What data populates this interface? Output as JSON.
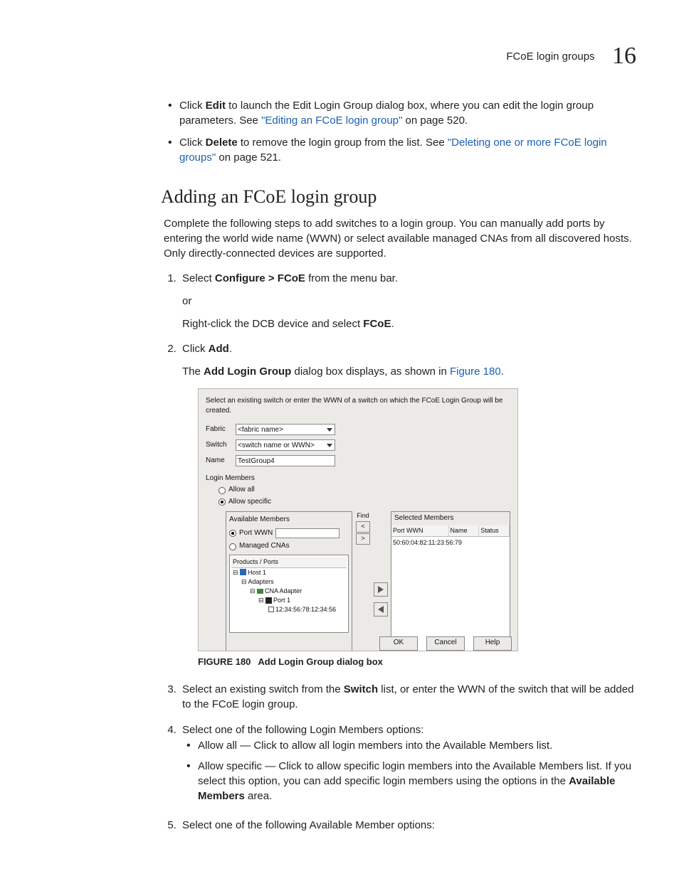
{
  "header": {
    "title": "FCoE login groups",
    "chapter": "16"
  },
  "prebullets": [
    {
      "pre": "Click ",
      "bold1": "Edit",
      "mid": " to launch the Edit Login Group dialog box, where you can edit the login group parameters. See ",
      "link": "\"Editing an FCoE login group\"",
      "post": " on page 520."
    },
    {
      "pre": "Click ",
      "bold1": "Delete",
      "mid": " to remove the login group from the list. See ",
      "link": "\"Deleting one or more FCoE login groups\"",
      "post": " on page 521."
    }
  ],
  "section_heading": "Adding an FCoE login group",
  "intro": "Complete the following steps to add switches to a login group. You can manually add ports by entering the world wide name (WWN) or select available managed CNAs from all discovered hosts. Only directly-connected devices are supported.",
  "steps": {
    "s1_pre": "Select ",
    "s1_bold": "Configure > FCoE",
    "s1_post": " from the menu bar.",
    "s1_or": "or",
    "s1_alt_pre": "Right-click the DCB device and select ",
    "s1_alt_bold": "FCoE",
    "s1_alt_post": ".",
    "s2_pre": "Click ",
    "s2_bold": "Add",
    "s2_post": ".",
    "s2_sub_pre": "The ",
    "s2_sub_bold": "Add Login Group",
    "s2_sub_mid": " dialog box displays, as shown in ",
    "s2_sub_link": "Figure 180",
    "s2_sub_post": ".",
    "s3_pre": "Select an existing switch from the ",
    "s3_bold": "Switch",
    "s3_post": " list, or enter the WWN of the switch that will be added to the FCoE login group.",
    "s4": "Select one of the following Login Members options:",
    "s4_a": "Allow all — Click to allow all login members into the Available Members list.",
    "s4_b_pre": "Allow specific — Click to allow specific login members into the Available Members list. If you select this option, you can add specific login members using the options in the ",
    "s4_b_bold": "Available Members",
    "s4_b_post": " area.",
    "s5": "Select one of the following Available Member options:"
  },
  "figure": {
    "label": "FIGURE 180",
    "caption": "Add Login Group dialog box"
  },
  "dialog": {
    "instruction": "Select an existing switch or enter the WWN of a switch on which the FCoE Login Group will be created.",
    "fabric_label": "Fabric",
    "fabric_value": "<fabric name>",
    "switch_label": "Switch",
    "switch_value": "<switch name or WWN>",
    "name_label": "Name",
    "name_value": "TestGroup4",
    "login_members_label": "Login Members",
    "allow_all_label": "Allow all",
    "allow_specific_label": "Allow specific",
    "available_members_label": "Available Members",
    "port_wwn_label": "Port WWN",
    "managed_cnas_label": "Managed CNAs",
    "tree_header": "Products / Ports",
    "tree": {
      "host": "Host 1",
      "adapters": "Adapters",
      "cna": "CNA Adapter",
      "port": "Port 1",
      "leaf": "12:34:56:78:12:34:56"
    },
    "find_label": "Find",
    "selected_members_label": "Selected Members",
    "sel_cols": {
      "c1": "Port WWN",
      "c2": "Name",
      "c3": "Status"
    },
    "sel_row": "50:60:04:82:11:23:56:79",
    "buttons": {
      "ok": "OK",
      "cancel": "Cancel",
      "help": "Help"
    }
  }
}
